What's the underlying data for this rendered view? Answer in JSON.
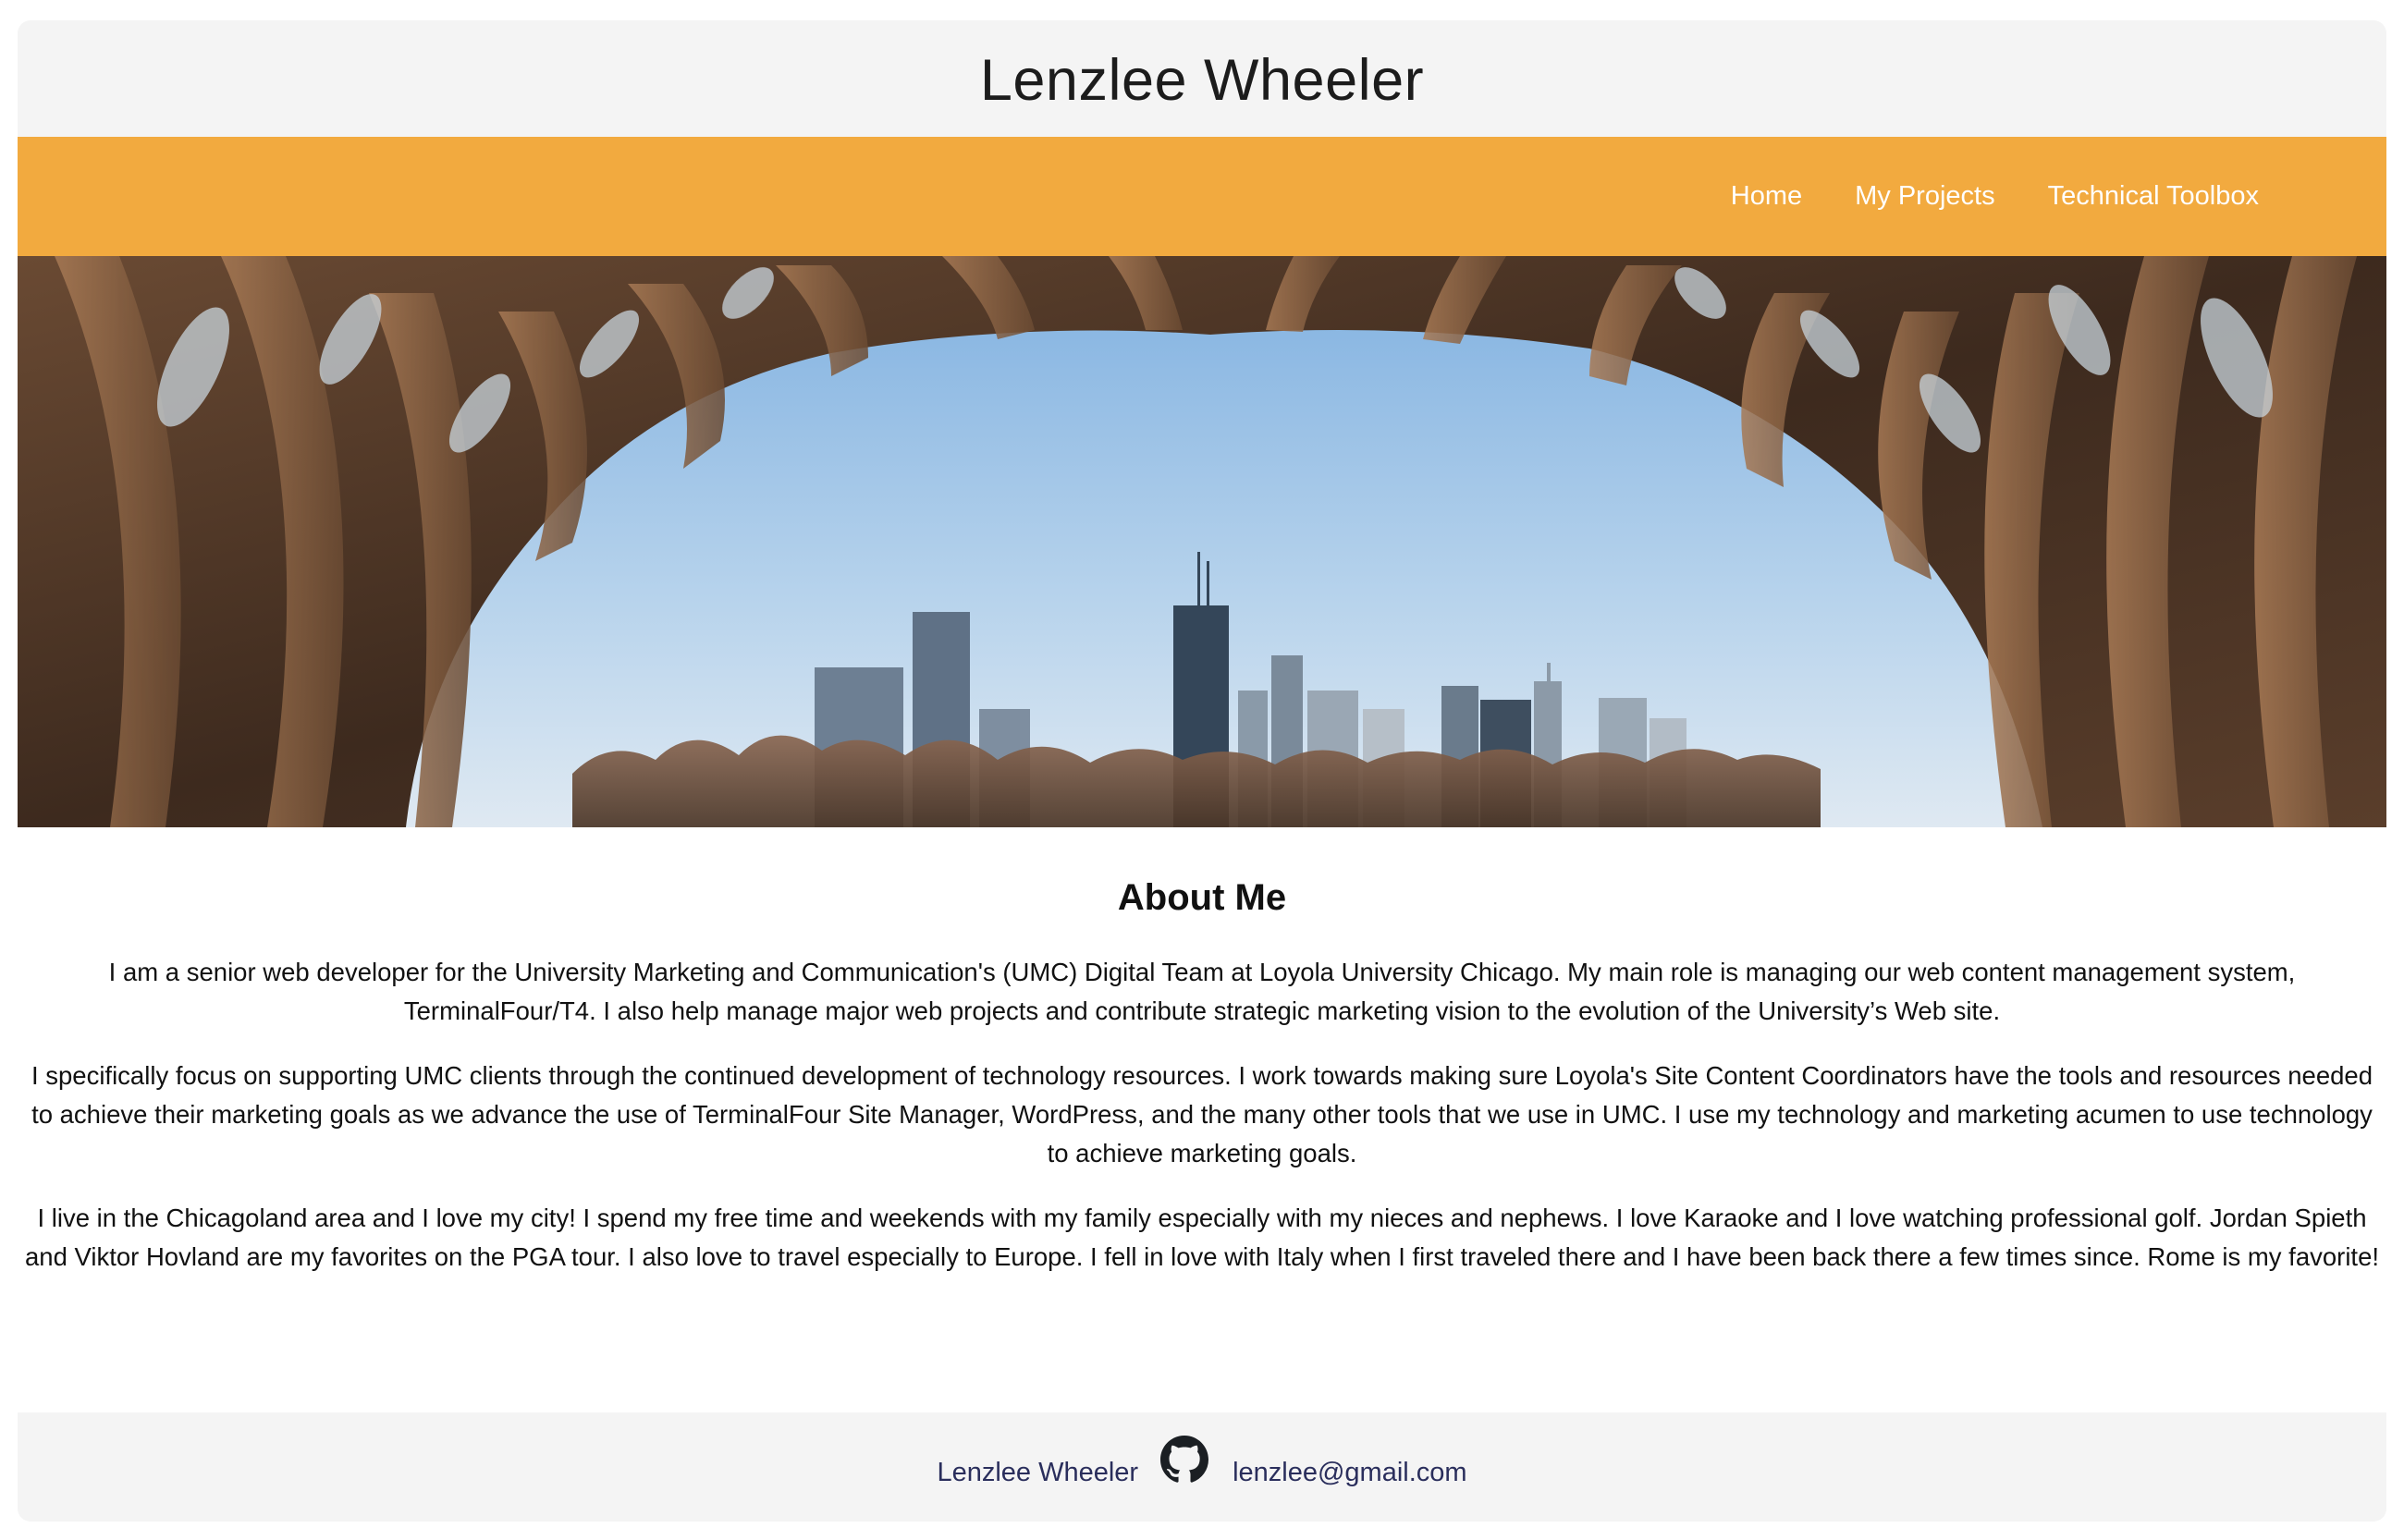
{
  "header": {
    "title": "Lenzlee Wheeler"
  },
  "nav": {
    "items": [
      {
        "label": "Home"
      },
      {
        "label": "My Projects"
      },
      {
        "label": "Technical Toolbox"
      }
    ]
  },
  "hero": {
    "image": "chicago-skyline-through-wooden-pavilion"
  },
  "about": {
    "heading": "About Me",
    "paragraphs": [
      "I am a senior web developer for the University Marketing and Communication's (UMC) Digital Team at Loyola University Chicago. My main role is managing our web content management system, TerminalFour/T4. I also help manage major web projects and contribute strategic marketing vision to the evolution of the University’s Web site.",
      "I specifically focus on supporting UMC clients through the continued development of technology resources. I work towards making sure Loyola's Site Content Coordinators have the tools and resources needed to achieve their marketing goals as we advance the use of TerminalFour Site Manager, WordPress, and the many other tools that we use in UMC. I use my technology and marketing acumen to use technology to achieve marketing goals.",
      "I live in the Chicagoland area and I love my city! I spend my free time and weekends with my family especially with my nieces and nephews. I love Karaoke and I love watching professional golf. Jordan Spieth and Viktor Hovland are my favorites on the PGA tour. I also love to travel especially to Europe. I fell in love with Italy when I first traveled there and I have been back there a few times since. Rome is my favorite!"
    ]
  },
  "footer": {
    "name": "Lenzlee Wheeler",
    "icon": "github-icon",
    "email": "lenzlee@gmail.com"
  },
  "colors": {
    "nav_background": "#f2aa3f",
    "header_background": "#f4f4f4",
    "footer_link": "#2a2e5c",
    "nav_text": "#ffffff"
  }
}
